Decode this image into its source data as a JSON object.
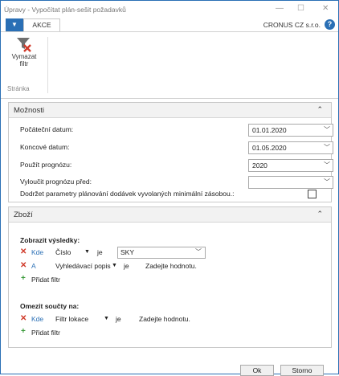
{
  "window": {
    "title": "Úpravy - Vypočítat plán-sešit požadavků"
  },
  "ribbon": {
    "tab_label": "AKCE",
    "company": "CRONUS CZ s.r.o.",
    "clear_filter_line1": "Vymazat",
    "clear_filter_line2": "filtr",
    "group_label": "Stránka"
  },
  "options": {
    "title": "Možnosti",
    "start_date_label": "Počáteční datum:",
    "start_date_value": "01.01.2020",
    "end_date_label": "Koncové datum:",
    "end_date_value": "01.05.2020",
    "forecast_label": "Použít prognózu:",
    "forecast_value": "2020",
    "exclude_forecast_label": "Vyloučit prognózu před:",
    "exclude_forecast_value": "",
    "respect_params_label": "Dodržet parametry plánování dodávek vyvolaných minimální zásobou.:",
    "respect_params_checked": false
  },
  "items": {
    "title": "Zboží",
    "show_results_label": "Zobrazit výsledky:",
    "filter1": {
      "prefix": "Kde",
      "field": "Číslo",
      "op": "je",
      "value": "SKY"
    },
    "filter2": {
      "prefix": "A",
      "field": "Vyhledávací popis",
      "op": "je",
      "value": "Zadejte hodnotu."
    },
    "add_filter_label": "Přidat filtr",
    "limit_totals_label": "Omezit součty na:",
    "filter3": {
      "prefix": "Kde",
      "field": "Filtr lokace",
      "op": "je",
      "value": "Zadejte hodnotu."
    },
    "add_filter2_label": "Přidat filtr"
  },
  "buttons": {
    "ok": "Ok",
    "cancel": "Storno"
  }
}
